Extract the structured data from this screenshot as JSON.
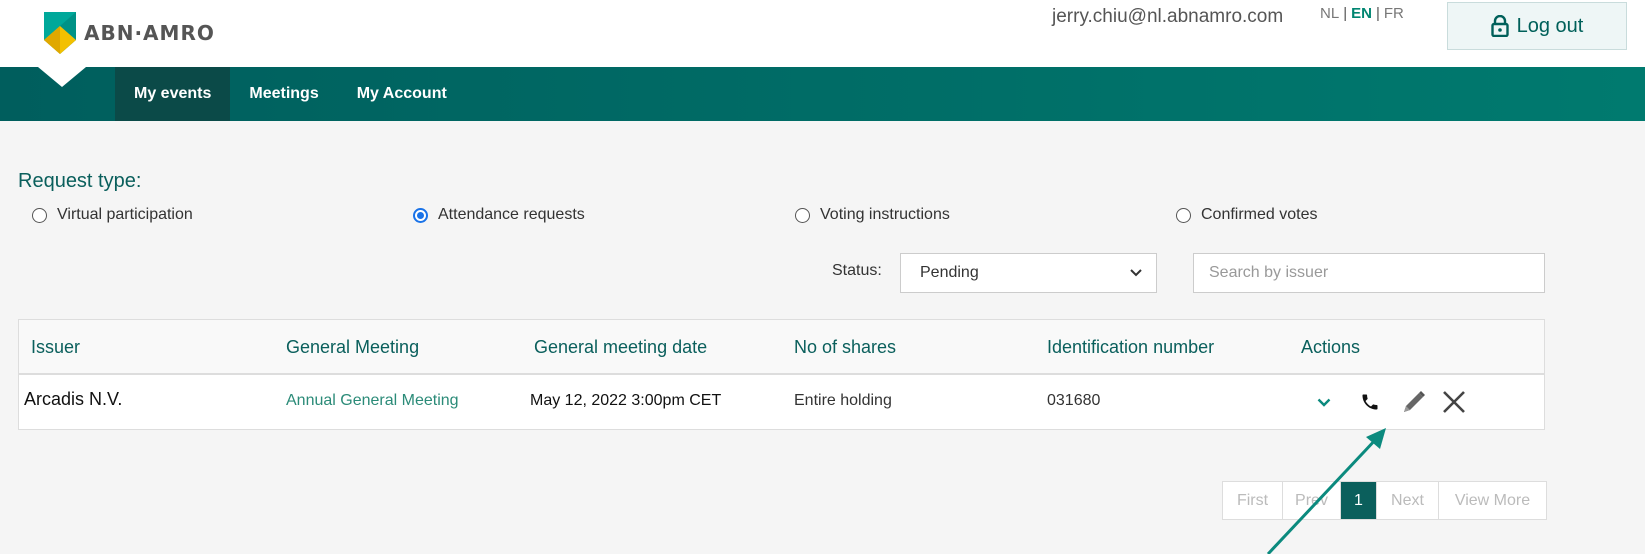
{
  "header": {
    "brand": "ABN·AMRO",
    "user_email": "jerry.chiu@nl.abnamro.com",
    "languages": [
      "NL",
      "EN",
      "FR"
    ],
    "active_language": "EN",
    "logout_label": "Log out"
  },
  "nav": {
    "items": [
      "My events",
      "Meetings",
      "My Account"
    ],
    "active": "My events"
  },
  "request_type": {
    "label": "Request type:",
    "options": [
      "Virtual participation",
      "Attendance requests",
      "Voting instructions",
      "Confirmed votes"
    ],
    "selected": "Attendance requests"
  },
  "filters": {
    "status_label": "Status:",
    "status_value": "Pending",
    "search_placeholder": "Search by issuer"
  },
  "table": {
    "headers": [
      "Issuer",
      "General Meeting",
      "General meeting date",
      "No of shares",
      "Identification number",
      "Actions"
    ],
    "rows": [
      {
        "issuer": "Arcadis N.V.",
        "general_meeting": "Annual General Meeting",
        "date": "May 12, 2022 3:00pm CET",
        "shares": "Entire holding",
        "id_number": "031680"
      }
    ],
    "action_icons": [
      "chevron-down-icon",
      "phone-icon",
      "pencil-icon",
      "close-icon"
    ]
  },
  "pagination": {
    "items": [
      "First",
      "Prev",
      "1",
      "Next",
      "View More"
    ],
    "current": "1"
  },
  "colors": {
    "brand_teal": "#007a6f",
    "nav_active": "#0b4a48",
    "header_text": "#0a5f5c",
    "link": "#2b8b78"
  }
}
